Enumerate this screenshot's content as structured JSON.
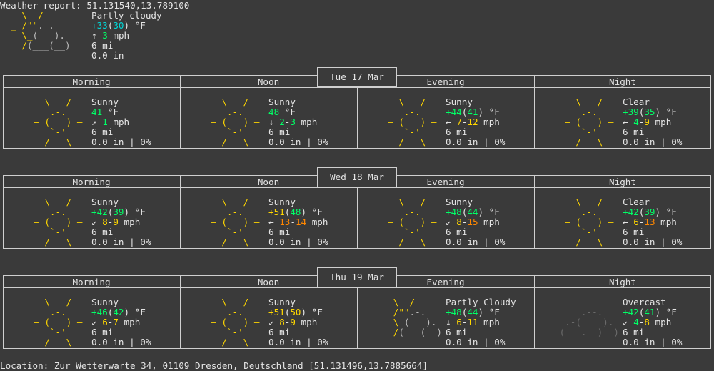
{
  "header": {
    "title": "Weather report: 51.131540,13.789100"
  },
  "current": {
    "condition": "Partly cloudy",
    "temp_plus": "+33",
    "temp_feel": "30",
    "temp_unit": " °F",
    "wind_arrow": "↑",
    "wind": "3",
    "wind_unit": " mph",
    "visibility": "6 mi",
    "precip": "0.0 in"
  },
  "periods": [
    "Morning",
    "Noon",
    "Evening",
    "Night"
  ],
  "days": [
    {
      "date": "Tue 17 Mar",
      "cells": [
        {
          "icon": "sun-icon",
          "condition": "Sunny",
          "temp": "41",
          "temp_feel": "",
          "wind_arrow": "↗",
          "wind_lo": "1",
          "wind_hi": "",
          "visibility": "6 mi",
          "precip": "0.0 in | 0%"
        },
        {
          "icon": "sun-icon",
          "condition": "Sunny",
          "temp": "48",
          "temp_feel": "",
          "wind_arrow": "↓",
          "wind_lo": "2",
          "wind_hi": "3",
          "visibility": "6 mi",
          "precip": "0.0 in | 0%"
        },
        {
          "icon": "sun-icon",
          "condition": "Sunny",
          "temp": "+44",
          "temp_feel": "41",
          "wind_arrow": "←",
          "wind_lo": "7",
          "wind_hi": "12",
          "visibility": "6 mi",
          "precip": "0.0 in | 0%"
        },
        {
          "icon": "moon-clear-icon",
          "condition": "Clear",
          "temp": "+39",
          "temp_feel": "35",
          "wind_arrow": "←",
          "wind_lo": "4",
          "wind_hi": "9",
          "visibility": "6 mi",
          "precip": "0.0 in | 0%"
        }
      ]
    },
    {
      "date": "Wed 18 Mar",
      "cells": [
        {
          "icon": "sun-icon",
          "condition": "Sunny",
          "temp": "+42",
          "temp_feel": "39",
          "wind_arrow": "↙",
          "wind_lo": "8",
          "wind_hi": "9",
          "visibility": "6 mi",
          "precip": "0.0 in | 0%"
        },
        {
          "icon": "sun-icon",
          "condition": "Sunny",
          "temp": "+51",
          "temp_feel": "48",
          "wind_arrow": "←",
          "wind_lo": "13",
          "wind_hi": "14",
          "visibility": "6 mi",
          "precip": "0.0 in | 0%"
        },
        {
          "icon": "sun-icon",
          "condition": "Sunny",
          "temp": "+48",
          "temp_feel": "44",
          "wind_arrow": "↙",
          "wind_lo": "8",
          "wind_hi": "15",
          "visibility": "6 mi",
          "precip": "0.0 in | 0%"
        },
        {
          "icon": "moon-clear-icon",
          "condition": "Clear",
          "temp": "+42",
          "temp_feel": "39",
          "wind_arrow": "←",
          "wind_lo": "6",
          "wind_hi": "13",
          "visibility": "6 mi",
          "precip": "0.0 in | 0%"
        }
      ]
    },
    {
      "date": "Thu 19 Mar",
      "cells": [
        {
          "icon": "sun-icon",
          "condition": "Sunny",
          "temp": "+46",
          "temp_feel": "42",
          "wind_arrow": "↙",
          "wind_lo": "6",
          "wind_hi": "7",
          "visibility": "6 mi",
          "precip": "0.0 in | 0%"
        },
        {
          "icon": "sun-icon",
          "condition": "Sunny",
          "temp": "+51",
          "temp_feel": "50",
          "wind_arrow": "↙",
          "wind_lo": "8",
          "wind_hi": "9",
          "visibility": "6 mi",
          "precip": "0.0 in | 0%"
        },
        {
          "icon": "partly-cloudy-icon",
          "condition": "Partly Cloudy",
          "temp": "+48",
          "temp_feel": "44",
          "wind_arrow": "↓",
          "wind_lo": "6",
          "wind_hi": "11",
          "visibility": "6 mi",
          "precip": "0.0 in | 0%"
        },
        {
          "icon": "overcast-cloud-icon",
          "condition": "Overcast",
          "temp": "+42",
          "temp_feel": "41",
          "wind_arrow": "↙",
          "wind_lo": "4",
          "wind_hi": "8",
          "visibility": "6 mi",
          "precip": "0.0 in | 0%"
        }
      ]
    }
  ],
  "footer": {
    "location": "Location: Zur Wetterwarte 34, 01109 Dresden, Deutschland [51.131496,13.7885664]"
  },
  "colors": {
    "background": "#3a3a3a",
    "text": "#e4e4e4",
    "sun_yellow": "#ffd700",
    "temp_green": "#00ff66",
    "temp_cyan": "#00d7d7",
    "wind_orange": "#ff8700",
    "border": "#cfcfcf"
  }
}
